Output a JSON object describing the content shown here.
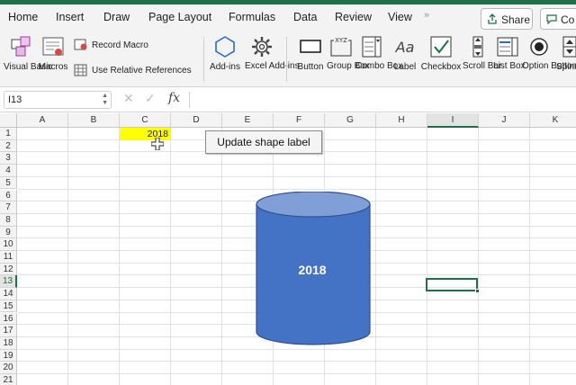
{
  "tabs": [
    "Home",
    "Insert",
    "Draw",
    "Page Layout",
    "Formulas",
    "Data",
    "Review",
    "View"
  ],
  "tab_more": "»",
  "share_label": "Share",
  "comments_label": "Co",
  "ribbon": {
    "visual_basic": "Visual Basic",
    "macros": "Macros",
    "record_macro": "Record Macro",
    "use_relative": "Use Relative References",
    "addins": "Add-ins",
    "excel_addins": "Excel Add-ins",
    "button": "Button",
    "group_box": "Group Box",
    "combo_box": "Combo Box",
    "label": "Label",
    "checkbox": "Checkbox",
    "scroll_bar": "Scroll Bar",
    "list_box": "List Box",
    "option_button": "Option Button",
    "spinner": "Spinn"
  },
  "formula_bar": {
    "name_box": "I13",
    "cancel_icon": "✕",
    "enter_icon": "✓",
    "fx_label": "fx",
    "formula": ""
  },
  "columns": [
    "A",
    "B",
    "C",
    "D",
    "E",
    "F",
    "G",
    "H",
    "I",
    "J",
    "K"
  ],
  "rows": [
    "1",
    "2",
    "3",
    "4",
    "5",
    "6",
    "7",
    "8",
    "9",
    "10",
    "11",
    "12",
    "13",
    "14",
    "15",
    "16",
    "17",
    "18",
    "19",
    "20",
    "21"
  ],
  "cell_c1": "2018",
  "macro_button_label": "Update shape label",
  "shape_label": "2018",
  "colors": {
    "accent": "#1e7145",
    "cell_highlight": "#ffff00",
    "shape_fill": "#4472c4",
    "shape_top": "#7f9fd6"
  }
}
